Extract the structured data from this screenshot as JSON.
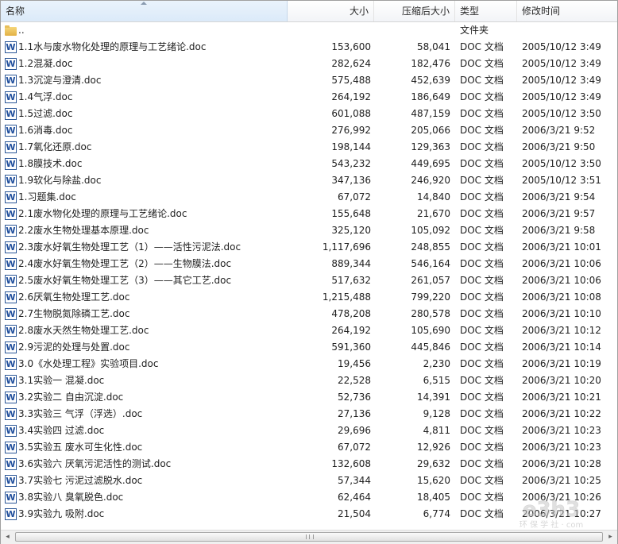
{
  "columns": {
    "name": "名称",
    "size": "大小",
    "compressed": "压缩后大小",
    "type": "类型",
    "modified": "修改时间"
  },
  "rows": [
    {
      "icon": "folder-icon",
      "name": "..",
      "size": "",
      "compressed": "",
      "type": "文件夹",
      "modified": ""
    },
    {
      "icon": "word-doc-icon",
      "name": "1.1水与废水物化处理的原理与工艺绪论.doc",
      "size": "153,600",
      "compressed": "58,041",
      "type": "DOC 文档",
      "modified": "2005/10/12 3:49"
    },
    {
      "icon": "word-doc-icon",
      "name": "1.2混凝.doc",
      "size": "282,624",
      "compressed": "182,476",
      "type": "DOC 文档",
      "modified": "2005/10/12 3:49"
    },
    {
      "icon": "word-doc-icon",
      "name": "1.3沉淀与澄清.doc",
      "size": "575,488",
      "compressed": "452,639",
      "type": "DOC 文档",
      "modified": "2005/10/12 3:49"
    },
    {
      "icon": "word-doc-icon",
      "name": "1.4气浮.doc",
      "size": "264,192",
      "compressed": "186,649",
      "type": "DOC 文档",
      "modified": "2005/10/12 3:49"
    },
    {
      "icon": "word-doc-icon",
      "name": "1.5过滤.doc",
      "size": "601,088",
      "compressed": "487,159",
      "type": "DOC 文档",
      "modified": "2005/10/12 3:50"
    },
    {
      "icon": "word-doc-icon",
      "name": "1.6消毒.doc",
      "size": "276,992",
      "compressed": "205,066",
      "type": "DOC 文档",
      "modified": "2006/3/21 9:52"
    },
    {
      "icon": "word-doc-icon",
      "name": "1.7氧化还原.doc",
      "size": "198,144",
      "compressed": "129,363",
      "type": "DOC 文档",
      "modified": "2006/3/21 9:50"
    },
    {
      "icon": "word-doc-icon",
      "name": "1.8膜技术.doc",
      "size": "543,232",
      "compressed": "449,695",
      "type": "DOC 文档",
      "modified": "2005/10/12 3:50"
    },
    {
      "icon": "word-doc-icon",
      "name": "1.9软化与除盐.doc",
      "size": "347,136",
      "compressed": "246,920",
      "type": "DOC 文档",
      "modified": "2005/10/12 3:51"
    },
    {
      "icon": "word-doc-icon",
      "name": "1.习题集.doc",
      "size": "67,072",
      "compressed": "14,840",
      "type": "DOC 文档",
      "modified": "2006/3/21 9:54"
    },
    {
      "icon": "word-doc-icon",
      "name": "2.1废水物化处理的原理与工艺绪论.doc",
      "size": "155,648",
      "compressed": "21,670",
      "type": "DOC 文档",
      "modified": "2006/3/21 9:57"
    },
    {
      "icon": "word-doc-icon",
      "name": "2.2废水生物处理基本原理.doc",
      "size": "325,120",
      "compressed": "105,092",
      "type": "DOC 文档",
      "modified": "2006/3/21 9:58"
    },
    {
      "icon": "word-doc-icon",
      "name": "2.3废水好氧生物处理工艺（1）——活性污泥法.doc",
      "size": "1,117,696",
      "compressed": "248,855",
      "type": "DOC 文档",
      "modified": "2006/3/21 10:01"
    },
    {
      "icon": "word-doc-icon",
      "name": "2.4废水好氧生物处理工艺（2）——生物膜法.doc",
      "size": "889,344",
      "compressed": "546,164",
      "type": "DOC 文档",
      "modified": "2006/3/21 10:06"
    },
    {
      "icon": "word-doc-icon",
      "name": "2.5废水好氧生物处理工艺（3）——其它工艺.doc",
      "size": "517,632",
      "compressed": "261,057",
      "type": "DOC 文档",
      "modified": "2006/3/21 10:06"
    },
    {
      "icon": "word-doc-icon",
      "name": "2.6厌氧生物处理工艺.doc",
      "size": "1,215,488",
      "compressed": "799,220",
      "type": "DOC 文档",
      "modified": "2006/3/21 10:08"
    },
    {
      "icon": "word-doc-icon",
      "name": "2.7生物脱氮除磷工艺.doc",
      "size": "478,208",
      "compressed": "280,578",
      "type": "DOC 文档",
      "modified": "2006/3/21 10:10"
    },
    {
      "icon": "word-doc-icon",
      "name": "2.8废水天然生物处理工艺.doc",
      "size": "264,192",
      "compressed": "105,690",
      "type": "DOC 文档",
      "modified": "2006/3/21 10:12"
    },
    {
      "icon": "word-doc-icon",
      "name": "2.9污泥的处理与处置.doc",
      "size": "591,360",
      "compressed": "445,846",
      "type": "DOC 文档",
      "modified": "2006/3/21 10:14"
    },
    {
      "icon": "word-doc-icon",
      "name": "3.0《水处理工程》实验项目.doc",
      "size": "19,456",
      "compressed": "2,230",
      "type": "DOC 文档",
      "modified": "2006/3/21 10:19"
    },
    {
      "icon": "word-doc-icon",
      "name": "3.1实验一 混凝.doc",
      "size": "22,528",
      "compressed": "6,515",
      "type": "DOC 文档",
      "modified": "2006/3/21 10:20"
    },
    {
      "icon": "word-doc-icon",
      "name": "3.2实验二 自由沉淀.doc",
      "size": "52,736",
      "compressed": "14,391",
      "type": "DOC 文档",
      "modified": "2006/3/21 10:21"
    },
    {
      "icon": "word-doc-icon",
      "name": "3.3实验三 气浮（浮选）.doc",
      "size": "27,136",
      "compressed": "9,128",
      "type": "DOC 文档",
      "modified": "2006/3/21 10:22"
    },
    {
      "icon": "word-doc-icon",
      "name": "3.4实验四 过滤.doc",
      "size": "29,696",
      "compressed": "4,811",
      "type": "DOC 文档",
      "modified": "2006/3/21 10:23"
    },
    {
      "icon": "word-doc-icon",
      "name": "3.5实验五 废水可生化性.doc",
      "size": "67,072",
      "compressed": "12,926",
      "type": "DOC 文档",
      "modified": "2006/3/21 10:23"
    },
    {
      "icon": "word-doc-icon",
      "name": "3.6实验六 厌氧污泥活性的测试.doc",
      "size": "132,608",
      "compressed": "29,632",
      "type": "DOC 文档",
      "modified": "2006/3/21 10:28"
    },
    {
      "icon": "word-doc-icon",
      "name": "3.7实验七 污泥过滤脱水.doc",
      "size": "57,344",
      "compressed": "15,620",
      "type": "DOC 文档",
      "modified": "2006/3/21 10:25"
    },
    {
      "icon": "word-doc-icon",
      "name": "3.8实验八 臭氧脱色.doc",
      "size": "62,464",
      "compressed": "18,405",
      "type": "DOC 文档",
      "modified": "2006/3/21 10:26"
    },
    {
      "icon": "word-doc-icon",
      "name": "3.9实验九 吸附.doc",
      "size": "21,504",
      "compressed": "6,774",
      "type": "DOC 文档",
      "modified": "2006/3/21 10:27"
    }
  ],
  "icons": {
    "word_letter": "W",
    "scroll_left": "◂",
    "scroll_right": "▸"
  },
  "watermark": {
    "logo_text": "e3h3",
    "caption": "环 保 学 社 · com"
  },
  "colors": {
    "word_blue": "#2b5797",
    "header_selected": "#dbeaf9",
    "folder_yellow": "#e8bf5a"
  }
}
